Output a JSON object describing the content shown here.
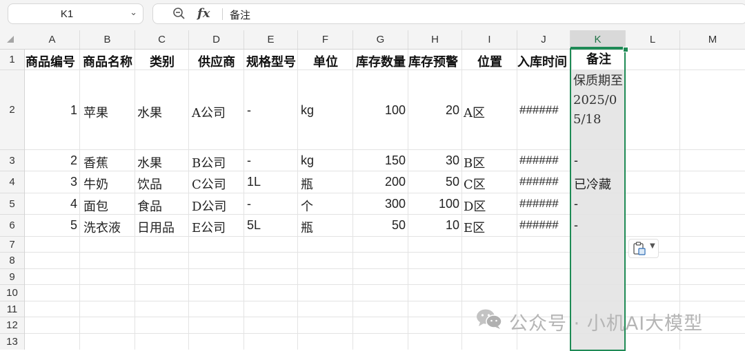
{
  "name_box": {
    "value": "K1"
  },
  "formula_bar": {
    "fx_label": "fx",
    "content": "备注"
  },
  "columns": [
    "A",
    "B",
    "C",
    "D",
    "E",
    "F",
    "G",
    "H",
    "I",
    "J",
    "K",
    "L",
    "M"
  ],
  "rows": [
    "1",
    "2",
    "3",
    "4",
    "5",
    "6",
    "7",
    "8",
    "9",
    "10",
    "11",
    "12",
    "13"
  ],
  "selected_column": "K",
  "headers": {
    "a": "商品编号",
    "b": "商品名称",
    "c": "类别",
    "d": "供应商",
    "e": "规格型号",
    "f": "单位",
    "g": "库存数量",
    "h": "库存预警",
    "i": "位置",
    "j": "入库时间",
    "k": "备注"
  },
  "data_rows": [
    {
      "a": "1",
      "b": "苹果",
      "c": "水果",
      "d": "A公司",
      "e": "-",
      "f": "kg",
      "g": "100",
      "h": "20",
      "i": "A区",
      "j": "######",
      "k": "保质期至2025/05/18"
    },
    {
      "a": "2",
      "b": "香蕉",
      "c": "水果",
      "d": "B公司",
      "e": "-",
      "f": "kg",
      "g": "150",
      "h": "30",
      "i": "B区",
      "j": "######",
      "k": "-"
    },
    {
      "a": "3",
      "b": "牛奶",
      "c": "饮品",
      "d": "C公司",
      "e": "1L",
      "f": "瓶",
      "g": "200",
      "h": "50",
      "i": "C区",
      "j": "######",
      "k": "已冷藏"
    },
    {
      "a": "4",
      "b": "面包",
      "c": "食品",
      "d": "D公司",
      "e": "-",
      "f": "个",
      "g": "300",
      "h": "100",
      "i": "D区",
      "j": "######",
      "k": "-"
    },
    {
      "a": "5",
      "b": "洗衣液",
      "c": "日用品",
      "d": "E公司",
      "e": "5L",
      "f": "瓶",
      "g": "50",
      "h": "10",
      "i": "E区",
      "j": "######",
      "k": "-"
    }
  ],
  "watermark": {
    "text": "公众号 · 小机AI大模型",
    "icon": "wechat-icon"
  },
  "colors": {
    "selection": "#1e8a55",
    "selected_fill": "#e6e6e6",
    "header_bg": "#f4f4f4",
    "grid": "#e3e3e3"
  }
}
